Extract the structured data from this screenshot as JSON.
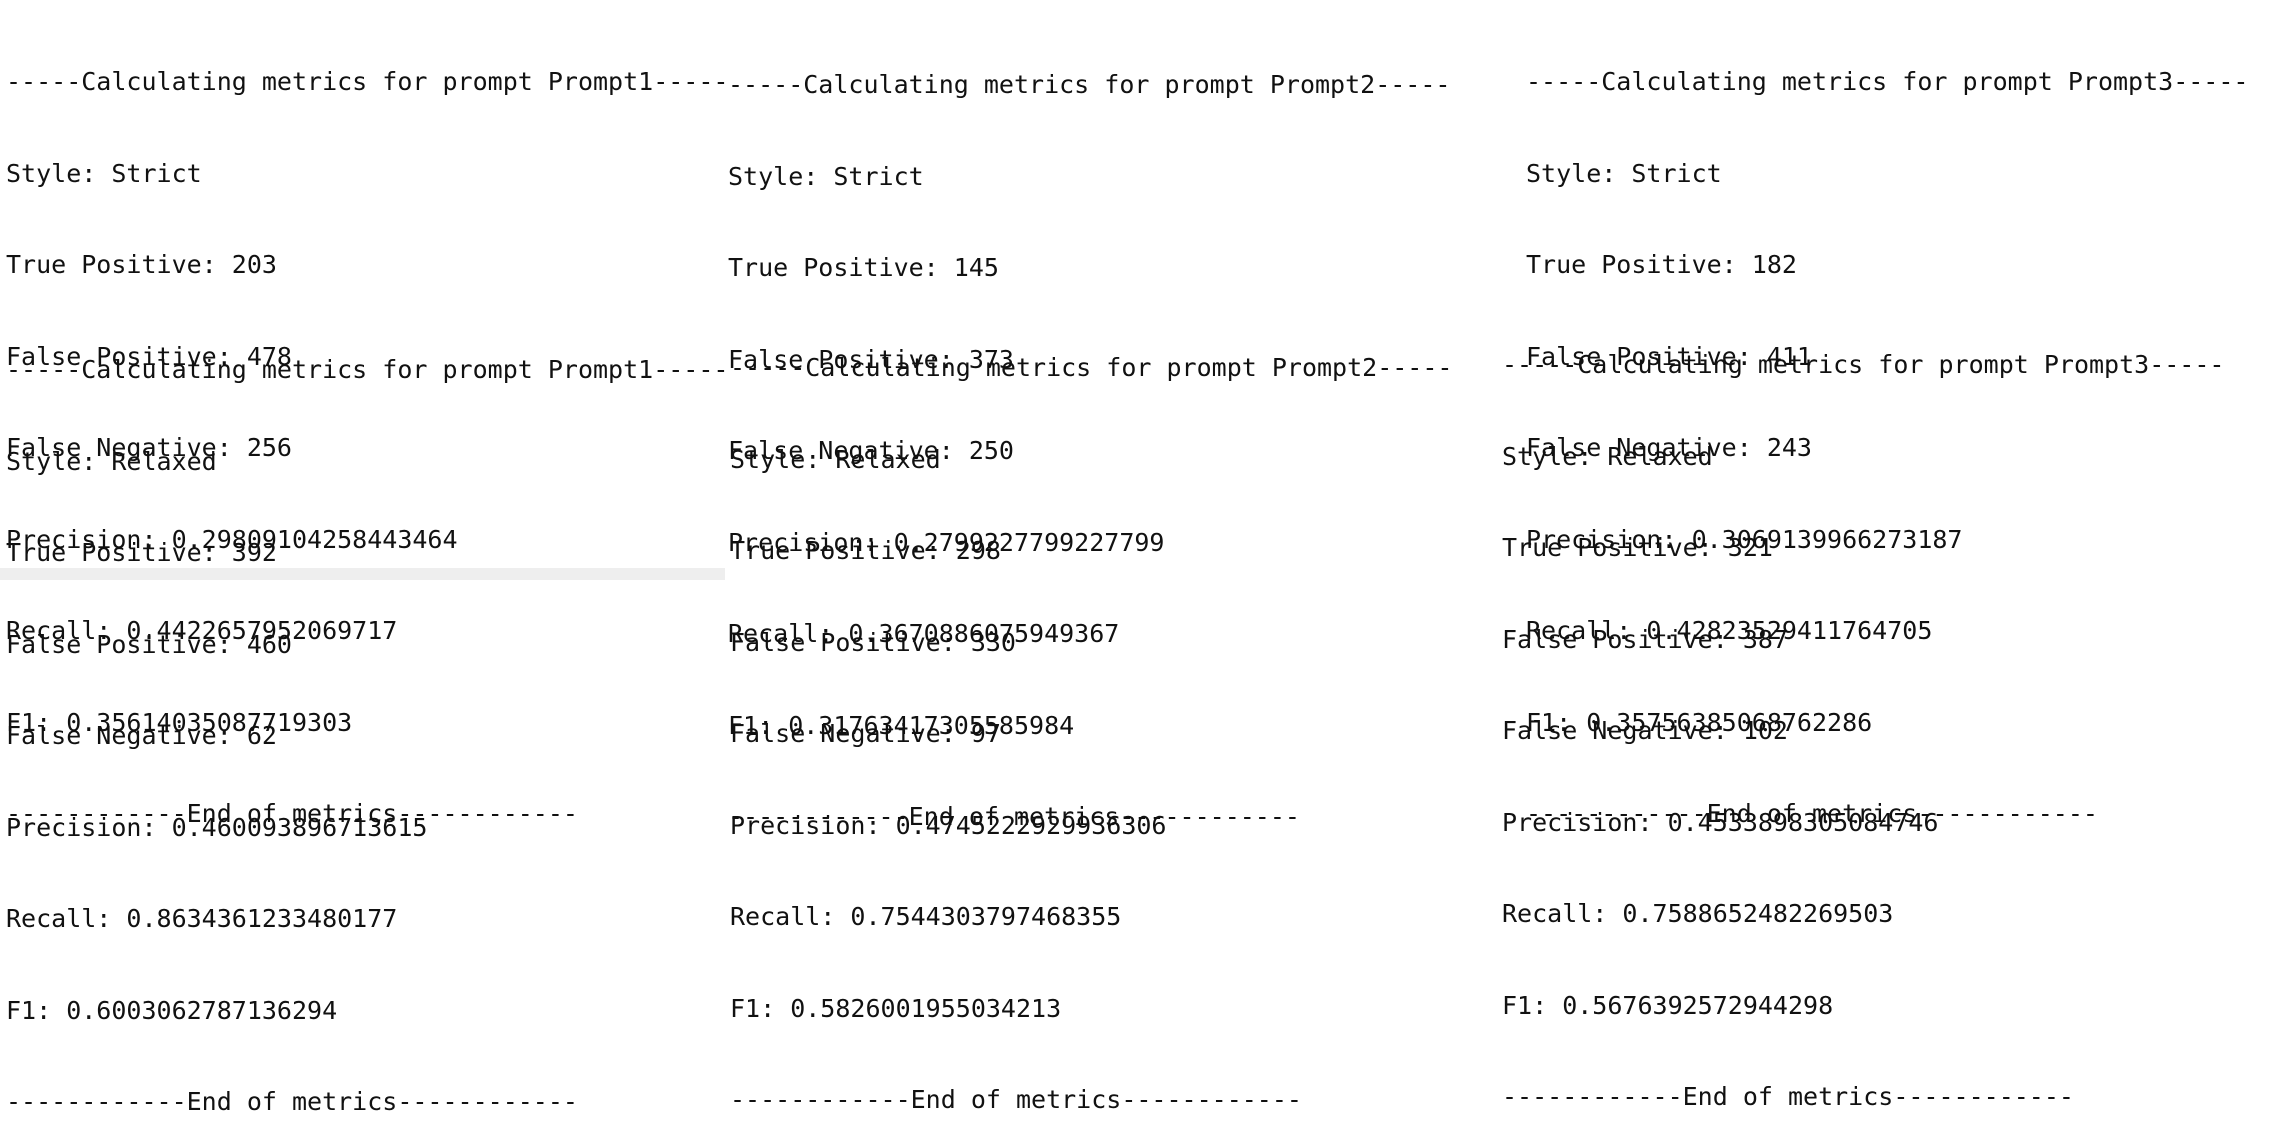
{
  "blocks": [
    {
      "header": "-----Calculating metrics for prompt Prompt1-----",
      "style": "Style: Strict",
      "tp": "True Positive: 203",
      "fp": "False Positive: 478",
      "fn": "False Negative: 256",
      "precision": "Precision: 0.29809104258443464",
      "recall": "Recall: 0.4422657952069717",
      "f1": "F1: 0.35614035087719303",
      "footer": "------------End of metrics------------"
    },
    {
      "header": "-----Calculating metrics for prompt Prompt2-----",
      "style": "Style: Strict",
      "tp": "True Positive: 145",
      "fp": "False Positive: 373",
      "fn": "False Negative: 250",
      "precision": "Precision: 0.2799227799227799",
      "recall": "Recall: 0.3670886075949367",
      "f1": "F1: 0.31763417305585984",
      "footer": "------------End of metrics------------"
    },
    {
      "header": "-----Calculating metrics for prompt Prompt3-----",
      "style": "Style: Strict",
      "tp": "True Positive: 182",
      "fp": "False Positive: 411",
      "fn": "False Negative: 243",
      "precision": "Precision: 0.3069139966273187",
      "recall": "Recall: 0.42823529411764705",
      "f1": "F1: 0.35756385068762286",
      "footer": "------------End of metrics------------"
    },
    {
      "header": "-----Calculating metrics for prompt Prompt1-----",
      "style": "Style: Relaxed",
      "tp": "True Positive: 392",
      "fp": "False Positive: 460",
      "fn": "False Negative: 62",
      "precision": "Precision: 0.460093896713615",
      "recall": "Recall: 0.8634361233480177",
      "f1": "F1: 0.6003062787136294",
      "footer": "------------End of metrics------------"
    },
    {
      "header": "-----Calculating metrics for prompt Prompt2-----",
      "style": "Style: Relaxed",
      "tp": "True Positive: 298",
      "fp": "False Positive: 330",
      "fn": "False Negative: 97",
      "precision": "Precision: 0.4745222929936306",
      "recall": "Recall: 0.7544303797468355",
      "f1": "F1: 0.5826001955034213",
      "footer": "------------End of metrics------------"
    },
    {
      "header": "-----Calculating metrics for prompt Prompt3-----",
      "style": "Style: Relaxed",
      "tp": "True Positive: 321",
      "fp": "False Positive: 387",
      "fn": "False Negative: 102",
      "precision": "Precision: 0.4533898305084746",
      "recall": "Recall: 0.7588652482269503",
      "f1": "F1: 0.5676392572944298",
      "footer": "------------End of metrics------------"
    }
  ]
}
